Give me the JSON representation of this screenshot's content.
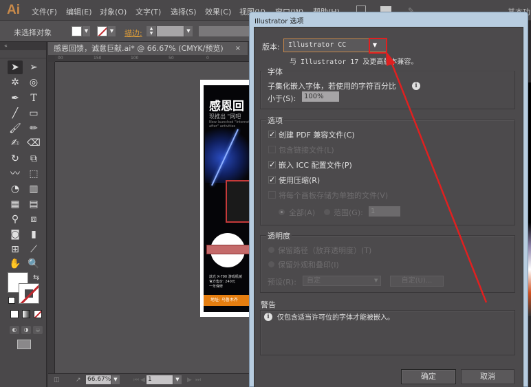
{
  "app": {
    "logo": "Ai",
    "menu": [
      "文件(F)",
      "编辑(E)",
      "对象(O)",
      "文字(T)",
      "选择(S)",
      "效果(C)",
      "视图(V)",
      "窗口(W)",
      "帮助(H)"
    ],
    "workspace": "基本功能"
  },
  "controlbar": {
    "selection_label": "未选择对象",
    "stroke_label": "描边:"
  },
  "document": {
    "tab_title": "感恩回馈，诚意巨献.ai* @ 66.67% (CMYK/预览)",
    "close_glyph": "×",
    "ruler_ticks": [
      "00",
      "150",
      "100",
      "50",
      "0"
    ],
    "artwork": {
      "title": "感恩回",
      "subtitle": "现推出 \"网吧",
      "subtitle_en": "New launched \"Internet\nafter\" activities",
      "caption": "炫光 X-790 游戏机械\n官方售价: 240元\n一年保修",
      "footer": "地址: 乌鲁木齐"
    }
  },
  "statusbar": {
    "zoom": "66.67%",
    "page": "1"
  },
  "dialog": {
    "title": "Illustrator 选项",
    "version_label": "版本:",
    "version_value": "Illustrator CC",
    "version_note": "与 Illustrator 17 及更高版本兼容。",
    "fonts": {
      "title": "字体",
      "subset_text": "子集化嵌入字体，若使用的字符百分比",
      "less_than_label": "小于(S):",
      "less_than_value": "100%"
    },
    "options": {
      "title": "选项",
      "items": [
        {
          "label": "创建 PDF 兼容文件(C)",
          "checked": true,
          "enabled": true
        },
        {
          "label": "包含链接文件(L)",
          "checked": false,
          "enabled": false
        },
        {
          "label": "嵌入 ICC 配置文件(P)",
          "checked": true,
          "enabled": true
        },
        {
          "label": "使用压缩(R)",
          "checked": true,
          "enabled": true
        },
        {
          "label": "将每个画板存储为单独的文件(V)",
          "checked": false,
          "enabled": false
        }
      ],
      "all_label": "全部(A)",
      "range_label": "范围(G):",
      "range_value": "1"
    },
    "transparency": {
      "title": "透明度",
      "preserve_paths": "保留路径（放弃透明度）(T)",
      "preserve_appearance": "保留外观和叠印(I)",
      "preset_label": "预设(R):",
      "preset_value": "自定",
      "custom_button": "自定(U)..."
    },
    "warnings": {
      "title": "警告",
      "message": "仅包含适当许可位的字体才能被嵌入。"
    },
    "ok_button": "确定",
    "cancel_button": "取消"
  },
  "annotation": {
    "color": "#e02020"
  }
}
